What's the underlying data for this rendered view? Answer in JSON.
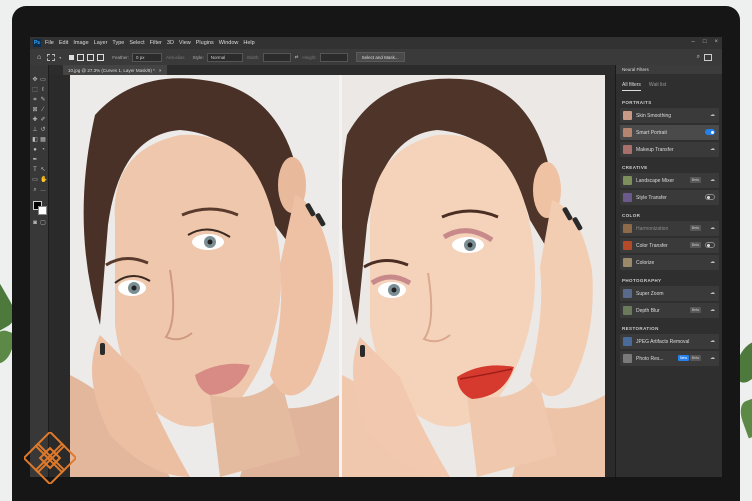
{
  "menu": {
    "app_logo": "Ps",
    "items": [
      "File",
      "Edit",
      "Image",
      "Layer",
      "Type",
      "Select",
      "Filter",
      "3D",
      "View",
      "Plugins",
      "Window",
      "Help"
    ]
  },
  "options_bar": {
    "feather_label": "Feather:",
    "feather_value": "0 px",
    "anti_alias_label": "Anti-alias",
    "style_label": "Style:",
    "style_value": "Normal",
    "width_label": "Width:",
    "height_label": "Height:",
    "select_mask_button": "Select and Mask..."
  },
  "document": {
    "tab_title": "10.jpg @ 27.3% (Curves 1, Layer Mask/8) *",
    "close_glyph": "×"
  },
  "panel": {
    "header": "Neural Filters",
    "tabs": {
      "all": "All filters",
      "wait": "Wait list"
    },
    "categories": [
      {
        "name": "PORTRAITS",
        "filters": [
          {
            "name": "Skin Smoothing",
            "control": "cloud",
            "color": "#c89a86"
          },
          {
            "name": "Smart Portrait",
            "control": "toggle-on",
            "badge": "",
            "color": "#b58570",
            "selected": true
          },
          {
            "name": "Makeup Transfer",
            "control": "cloud",
            "color": "#a8706a"
          }
        ]
      },
      {
        "name": "CREATIVE",
        "filters": [
          {
            "name": "Landscape Mixer",
            "control": "cloud",
            "badge": "Beta",
            "color": "#7d8f5a"
          },
          {
            "name": "Style Transfer",
            "control": "toggle-off",
            "color": "#6a5b8c"
          }
        ]
      },
      {
        "name": "COLOR",
        "filters": [
          {
            "name": "Harmonization",
            "control": "cloud",
            "badge": "Beta",
            "color": "#8c6a4a",
            "dim": true
          },
          {
            "name": "Color Transfer",
            "control": "toggle-off",
            "badge": "Beta",
            "color": "#b44a2a"
          },
          {
            "name": "Colorize",
            "control": "cloud",
            "color": "#9a8a6a"
          }
        ]
      },
      {
        "name": "PHOTOGRAPHY",
        "filters": [
          {
            "name": "Super Zoom",
            "control": "cloud",
            "color": "#5a6a8a"
          },
          {
            "name": "Depth Blur",
            "control": "cloud",
            "badge": "Beta",
            "color": "#6a7a5a"
          }
        ]
      },
      {
        "name": "RESTORATION",
        "filters": [
          {
            "name": "JPEG Artifacts Removal",
            "control": "cloud",
            "color": "#4a6a9a"
          },
          {
            "name": "Photo Res...",
            "control": "cloud",
            "badge_new": "New",
            "badge": "Beta",
            "color": "#7a7a7a"
          }
        ]
      }
    ]
  },
  "colors": {
    "accent": "#2680eb",
    "panel_bg": "#2f2f2f",
    "logo": "#e07a2a"
  }
}
